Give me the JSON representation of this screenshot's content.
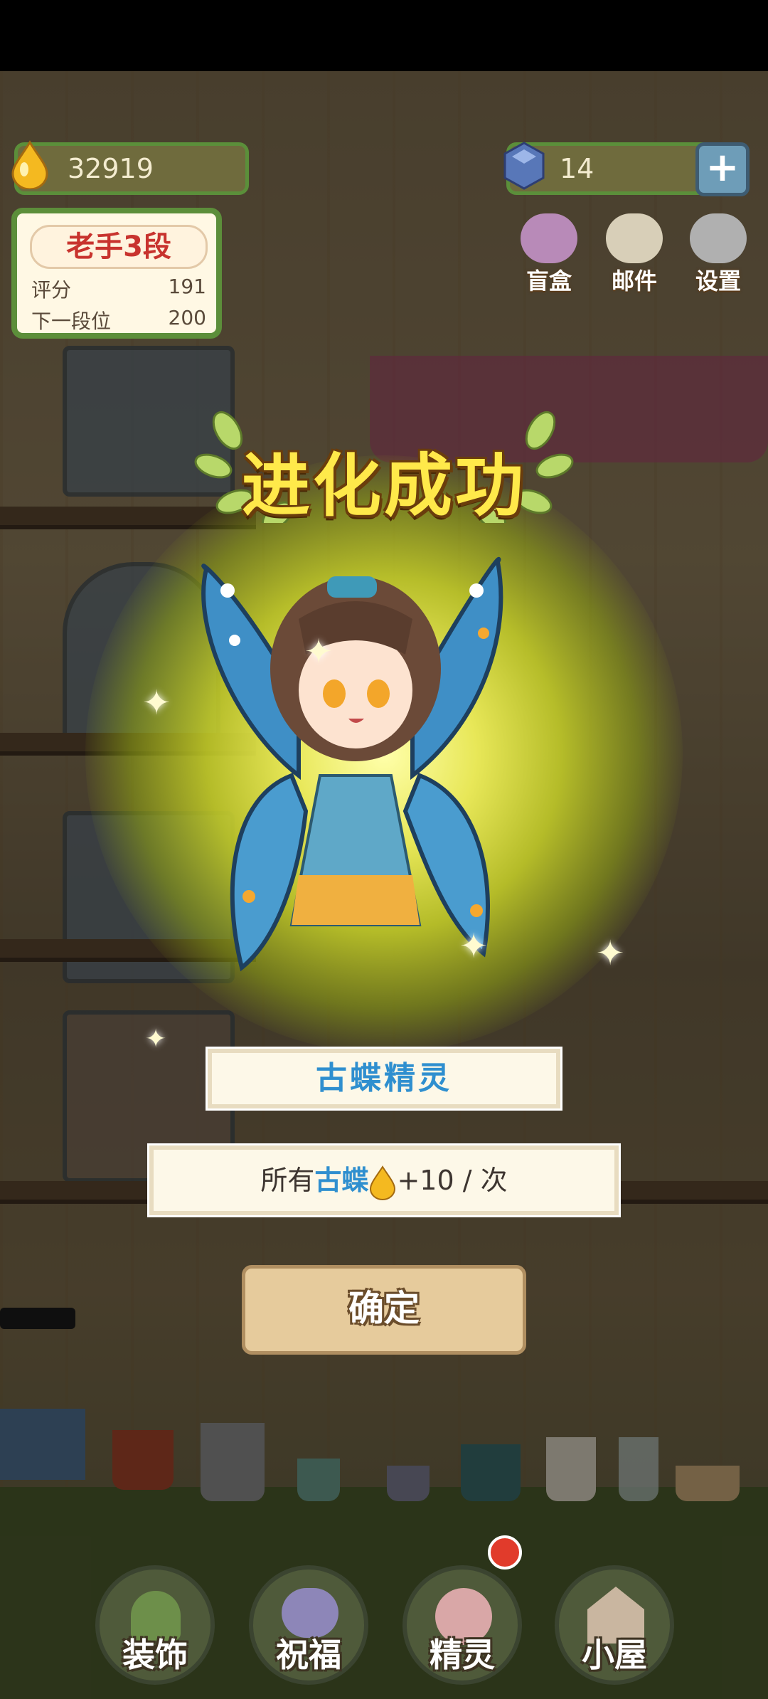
{
  "hud": {
    "drops": "32919",
    "gems": "14",
    "plus_label": "+"
  },
  "rank": {
    "title": "老手3段",
    "score_label": "评分",
    "score_value": "191",
    "next_label": "下一段位",
    "next_value": "200"
  },
  "top_buttons": [
    {
      "label": "盲盒",
      "icon": "gift-box-icon"
    },
    {
      "label": "邮件",
      "icon": "mail-icon"
    },
    {
      "label": "设置",
      "icon": "gear-icon"
    }
  ],
  "popup": {
    "title": "进化成功",
    "character_name": "古蝶精灵",
    "bonus_prefix": "所有",
    "bonus_highlight": "古蝶",
    "bonus_suffix": "+10 / 次",
    "confirm_label": "确定"
  },
  "nav": [
    {
      "label": "装饰",
      "icon": "plant-icon"
    },
    {
      "label": "祝福",
      "icon": "butterfly-icon"
    },
    {
      "label": "精灵",
      "icon": "fairy-icon"
    },
    {
      "label": "小屋",
      "icon": "house-icon"
    }
  ],
  "colors": {
    "accent_blue": "#2f8fcf",
    "title_yellow": "#ffe94a",
    "rank_red": "#c8332e"
  }
}
